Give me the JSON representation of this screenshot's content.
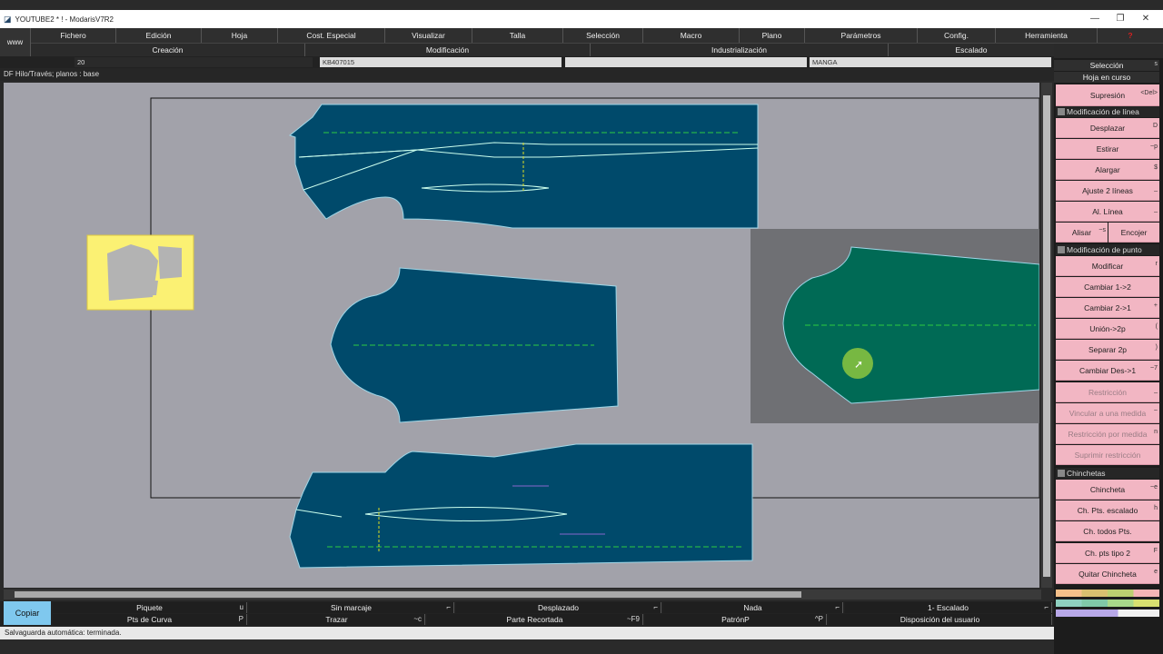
{
  "window": {
    "title": "YOUTUBE2 * ! - ModarisV7R2",
    "minimize": "—",
    "maximize": "❐",
    "close": "✕"
  },
  "menu": [
    "Fichero",
    "Edición",
    "Hoja",
    "Cost. Especial",
    "Visualizar",
    "Talla",
    "Selección",
    "Macro",
    "Plano",
    "Parámetros",
    "Config.",
    "Herramienta"
  ],
  "help_icon": "?",
  "www_label": "www",
  "submenu": {
    "creacion": "Creación",
    "modificacion": "Modificación",
    "industrializacion": "Industrialización",
    "escalado": "Escalado"
  },
  "info": {
    "number": "20",
    "model": "KB407015",
    "piece": "MANGA"
  },
  "hilo_text": "DF Hilo/Través;    planos :  base",
  "right_panel": {
    "title": "Selección",
    "title_key": "s",
    "subtitle": "Hoja en curso",
    "buttons": [
      {
        "label": "Supresión",
        "key": "<Del>"
      },
      {
        "section": "Modificación de línea"
      },
      {
        "label": "Desplazar",
        "key": "D"
      },
      {
        "label": "Estirar",
        "key": "~p"
      },
      {
        "label": "Alargar",
        "key": "$"
      },
      {
        "label": "Ajuste 2 líneas",
        "key": "_"
      },
      {
        "label": "Al. Línea",
        "key": "_"
      },
      {
        "split": [
          "Alisar",
          "Encojer"
        ],
        "key": "~s"
      },
      {
        "section": "Modificación de punto"
      },
      {
        "label": "Modificar",
        "key": "r"
      },
      {
        "label": "Cambiar 1->2",
        "key": ""
      },
      {
        "label": "Cambiar 2->1",
        "key": "+"
      },
      {
        "label": "Unión->2p",
        "key": "("
      },
      {
        "label": "Separar 2p",
        "key": ")"
      },
      {
        "label": "Cambiar Des->1",
        "key": "~7"
      },
      {
        "label": "Restricción",
        "key": "_",
        "disabled": true
      },
      {
        "label": "Vincular a una medida",
        "key": "~",
        "disabled": true
      },
      {
        "label": "Restricción por medida",
        "key": "n",
        "disabled": true
      },
      {
        "label": "Suprimir restricción",
        "key": "",
        "disabled": true
      },
      {
        "section": "Chinchetas"
      },
      {
        "label": "Chincheta",
        "key": "~e"
      },
      {
        "label": "Ch. Pts. escalado",
        "key": "h"
      },
      {
        "label": "Ch. todos Pts.",
        "key": ""
      },
      {
        "label": "Ch. pts tipo 2",
        "key": "F"
      },
      {
        "label": "Quitar Chincheta",
        "key": "e"
      }
    ]
  },
  "bottom": {
    "copy": "Copiar",
    "row1": [
      {
        "label": "Piquete",
        "key": "u"
      },
      {
        "label": "Sin marcaje",
        "key": "⌐"
      },
      {
        "label": "Desplazado",
        "key": "⌐"
      },
      {
        "label": "Nada",
        "key": "⌐"
      },
      {
        "label": "1- Escalado",
        "key": "⌐"
      }
    ],
    "row2": [
      {
        "label": "Pts de Curva",
        "key": "P"
      },
      {
        "label": "Trazar",
        "key": "~c"
      },
      {
        "label": "Parte Recortada",
        "key": "~F9"
      },
      {
        "label": "PatrónP",
        "key": "^P"
      },
      {
        "label": "Disposición del usuario",
        "key": ""
      }
    ]
  },
  "status": "Salvaguarda automática: terminada.",
  "colors": {
    "piece_fill": "#004a6b",
    "selected_fill": "#006a55",
    "canvas": "#a2a2aa",
    "panel_button": "#f2b6c3"
  }
}
